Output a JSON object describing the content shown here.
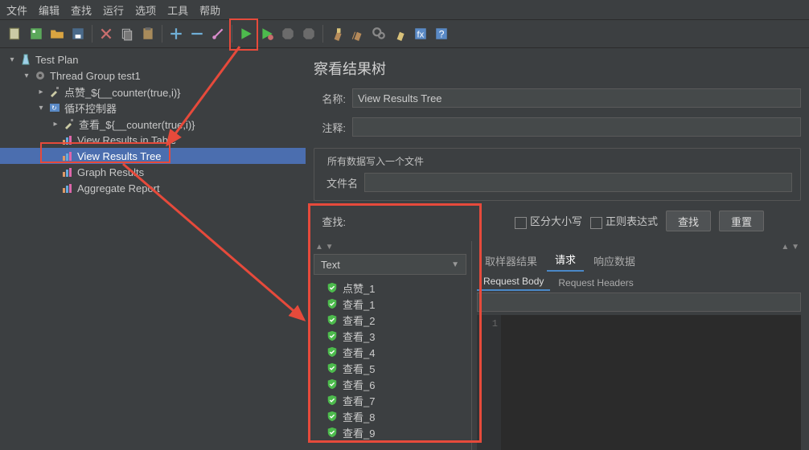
{
  "menu": [
    "文件",
    "编辑",
    "查找",
    "运行",
    "选项",
    "工具",
    "帮助"
  ],
  "tree": {
    "root": "Test Plan",
    "thread_group": "Thread Group test1",
    "sampler1": "点赞_${__counter(true,i)}",
    "loop_ctrl": "循环控制器",
    "sampler2": "查看_${__counter(true,i)}",
    "view_table": "View Results in Table",
    "view_tree": "View Results Tree",
    "graph": "Graph Results",
    "aggregate": "Aggregate Report"
  },
  "panel": {
    "title": "察看结果树",
    "name_label": "名称:",
    "name_value": "View Results Tree",
    "comment_label": "注释:",
    "group_label": "所有数据写入一个文件",
    "file_label": "文件名",
    "search_label": "查找:",
    "chk_case": "区分大小写",
    "chk_regex": "正则表达式",
    "btn_search": "查找",
    "btn_reset": "重置",
    "combo": "Text",
    "tabs": {
      "sampler": "取样器结果",
      "request": "请求",
      "response": "响应数据"
    },
    "subtabs": {
      "body": "Request Body",
      "headers": "Request Headers"
    },
    "results": [
      "点赞_1",
      "查看_1",
      "查看_2",
      "查看_3",
      "查看_4",
      "查看_5",
      "查看_6",
      "查看_7",
      "查看_8",
      "查看_9"
    ],
    "gutter": "1"
  }
}
